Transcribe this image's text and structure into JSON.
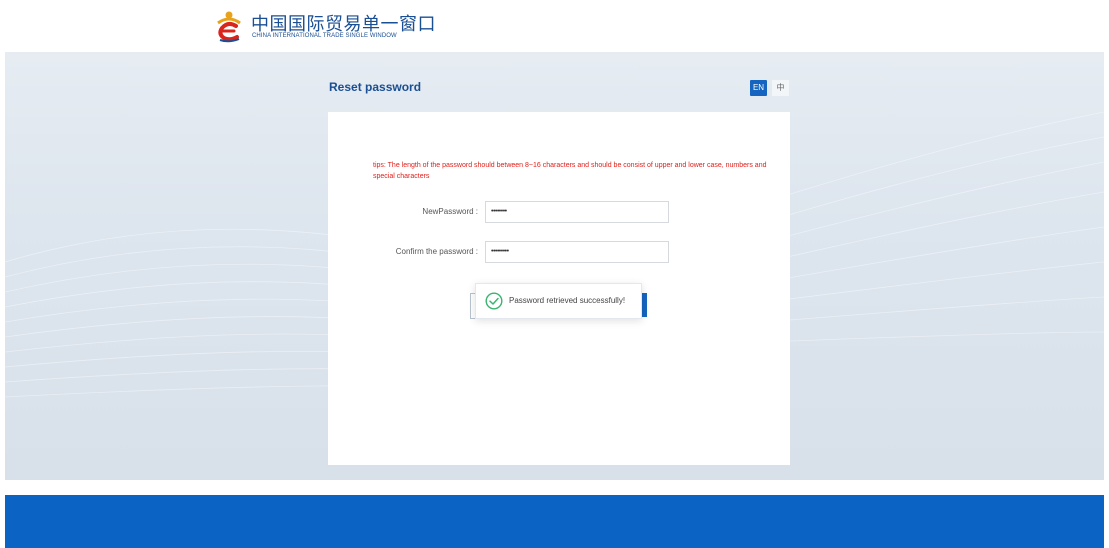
{
  "header": {
    "logo_title": "中国国际贸易单一窗口",
    "logo_subtitle": "CHINA INTERNATIONAL TRADE SINGLE WINDOW",
    "logo_icon": "single-window-logo"
  },
  "page": {
    "title": "Reset password",
    "lang_en": "EN",
    "lang_zh": "中"
  },
  "form": {
    "tips": "tips: The length of the password should between 8~16 characters and should be consist of upper and lower case, numbers and special characters",
    "new_password_label": "NewPassword :",
    "new_password_value": "••••••••",
    "confirm_password_label": "Confirm the password :",
    "confirm_password_value": "•••••••••"
  },
  "toast": {
    "message": "Password retrieved successfully!",
    "icon": "check-circle-icon",
    "color": "#3cb371"
  },
  "colors": {
    "brand_blue": "#1565c0",
    "footer_blue": "#0b64c4",
    "tips_red": "#e0201b"
  }
}
